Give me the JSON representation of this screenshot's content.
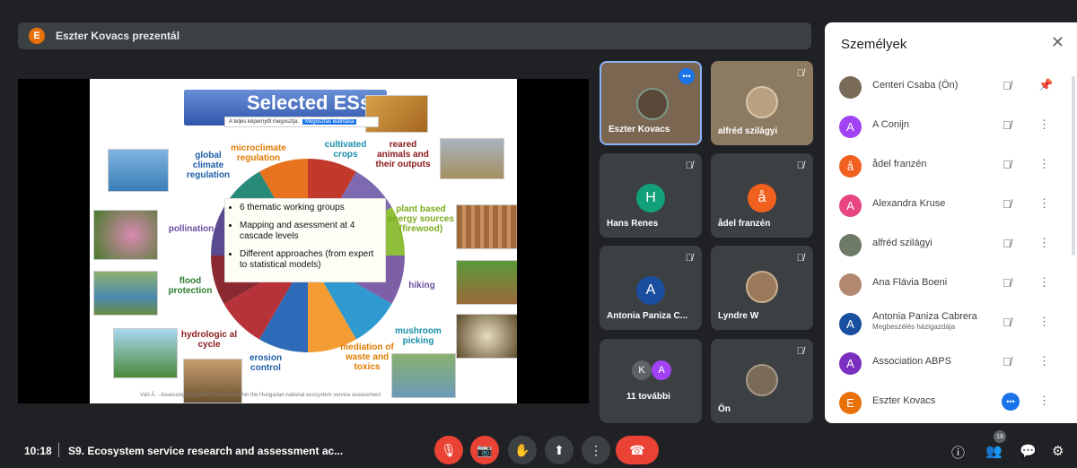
{
  "banner": {
    "avatar_letter": "E",
    "text": "Eszter Kovacs prezentál"
  },
  "slide": {
    "title": "Selected ESs",
    "share_text": "A teljes képernyőt megosztja.",
    "share_button": "Megosztás leállítása",
    "labels": {
      "global_climate": "global climate regulation",
      "microclimate": "microclimate regulation",
      "cultivated": "cultivated crops",
      "reared": "reared animals and their outputs",
      "plant_energy": "plant based energy sources (firewood)",
      "pollination": "pollination",
      "flood": "flood protection",
      "hiking": "hiking",
      "hydrologic": "hydrologic al cycle",
      "erosion": "erosion control",
      "mediation": "mediation of waste and toxics",
      "mushroom": "mushroom picking"
    },
    "bullets": [
      "6 thematic working groups",
      "Mapping and asessment at 4 cascade levels",
      "Different approaches (from expert to statistical models)"
    ],
    "footer": "Vári Á. - Assessing ecosystem services within the Hungarian national ecosystem service assessment"
  },
  "tiles": [
    {
      "name": "Eszter Kovacs"
    },
    {
      "name": "alfréd szilágyi"
    },
    {
      "name": "Hans Renes",
      "letter": "H",
      "color": "#12a07a"
    },
    {
      "name": "ådel franzén",
      "letter": "å",
      "color": "#f0611f"
    },
    {
      "name": "Antonia Paniza C...",
      "letter": "A",
      "color": "#1a4fa0"
    },
    {
      "name": "Lyndre W"
    },
    {
      "name": "11 további",
      "letters": [
        "K",
        "A"
      ]
    },
    {
      "name": "Ön"
    }
  ],
  "panel": {
    "title": "Személyek",
    "people": [
      {
        "name": "Centeri Csaba (Ön)",
        "letter": "",
        "color": "#7a6a58"
      },
      {
        "name": "A Conijn",
        "letter": "A",
        "color": "#a142f4"
      },
      {
        "name": "ådel franzén",
        "letter": "å",
        "color": "#f0611f"
      },
      {
        "name": "Alexandra Kruse",
        "letter": "A",
        "color": "#e84680"
      },
      {
        "name": "alfréd szilágyi",
        "letter": "",
        "color": "#6d7a65"
      },
      {
        "name": "Ana Flávia Boeni",
        "letter": "",
        "color": "#b28870"
      },
      {
        "name": "Antonia Paniza Cabrera",
        "sub": "Megbeszélés házigazdája",
        "letter": "A",
        "color": "#1a4fa0"
      },
      {
        "name": "Association ABPS",
        "letter": "A",
        "color": "#7b2fbf"
      },
      {
        "name": "Eszter Kovacs",
        "letter": "E",
        "color": "#e8710a"
      }
    ]
  },
  "bottom": {
    "time": "10:18",
    "meeting": "S9. Ecosystem service research and assessment ac...",
    "people_count": "19"
  }
}
